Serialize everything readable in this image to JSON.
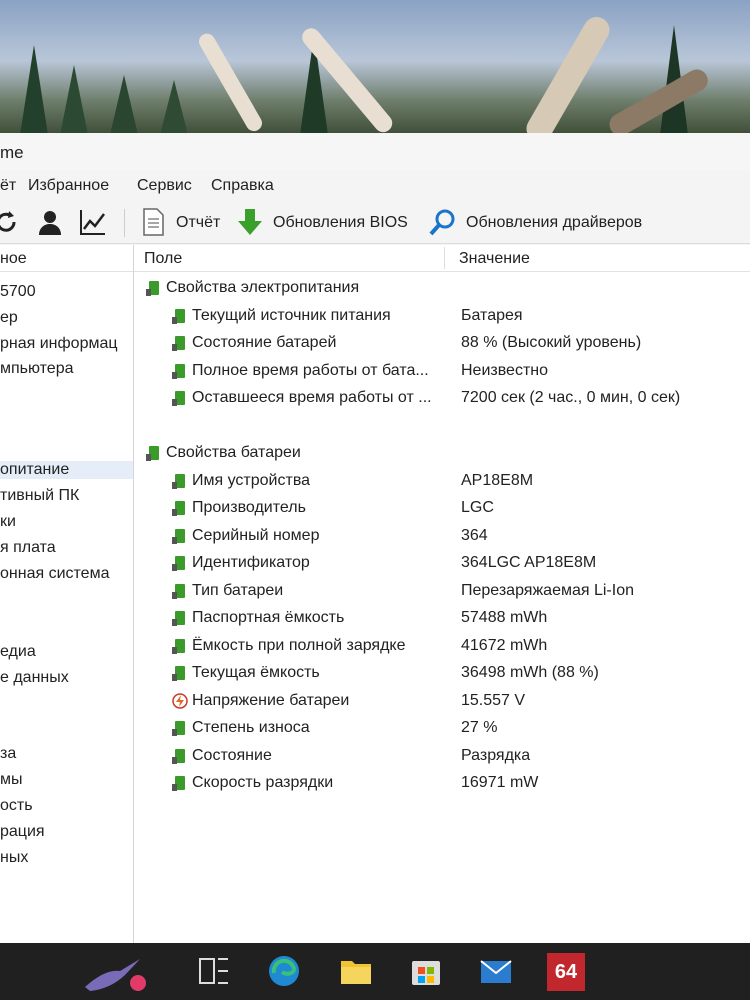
{
  "window": {
    "title_fragment": "me"
  },
  "menu": [
    "ёт",
    "Избранное",
    "Сервис",
    "Справка"
  ],
  "toolbar": {
    "report": "Отчёт",
    "bios_updates": "Обновления BIOS",
    "driver_updates": "Обновления драйверов"
  },
  "sidebar": {
    "header": "ное",
    "items": [
      "5700",
      "ер",
      "рная информац",
      "мпьютера",
      "опитание",
      "тивный ПК",
      "ки",
      "я плата",
      "онная система",
      "едиа",
      "е данных",
      "за",
      "мы",
      "ость",
      "рация",
      "ных"
    ],
    "selected": "опитание"
  },
  "table": {
    "col_field": "Поле",
    "col_value": "Значение",
    "groups": [
      {
        "title": "Свойства электропитания",
        "rows": [
          {
            "field": "Текущий источник питания",
            "value": "Батарея"
          },
          {
            "field": "Состояние батарей",
            "value": "88 % (Высокий уровень)"
          },
          {
            "field": "Полное время работы от бата...",
            "value": "Неизвестно"
          },
          {
            "field": "Оставшееся время работы от ...",
            "value": "7200 сек (2 час., 0 мин, 0 сек)"
          }
        ]
      },
      {
        "title": "Свойства батареи",
        "rows": [
          {
            "field": "Имя устройства",
            "value": "AP18E8M"
          },
          {
            "field": "Производитель",
            "value": "LGC"
          },
          {
            "field": "Серийный номер",
            "value": "364"
          },
          {
            "field": "Идентификатор",
            "value": "364LGC AP18E8M"
          },
          {
            "field": "Тип батареи",
            "value": "Перезаряжаемая Li-Ion"
          },
          {
            "field": "Паспортная ёмкость",
            "value": "57488 mWh"
          },
          {
            "field": "Ёмкость при полной зарядке",
            "value": "41672 mWh"
          },
          {
            "field": "Текущая ёмкость",
            "value": "36498 mWh  (88 %)"
          },
          {
            "field": "Напряжение батареи",
            "value": "15.557 V",
            "icon": "voltage"
          },
          {
            "field": "Степень износа",
            "value": "27 %"
          },
          {
            "field": "Состояние",
            "value": "Разрядка"
          },
          {
            "field": "Скорость разрядки",
            "value": "16971 mW"
          }
        ]
      }
    ]
  },
  "taskbar": {
    "badge": "64"
  },
  "colors": {
    "battery_green": "#3a9a2a",
    "accent": "#0078d4"
  }
}
